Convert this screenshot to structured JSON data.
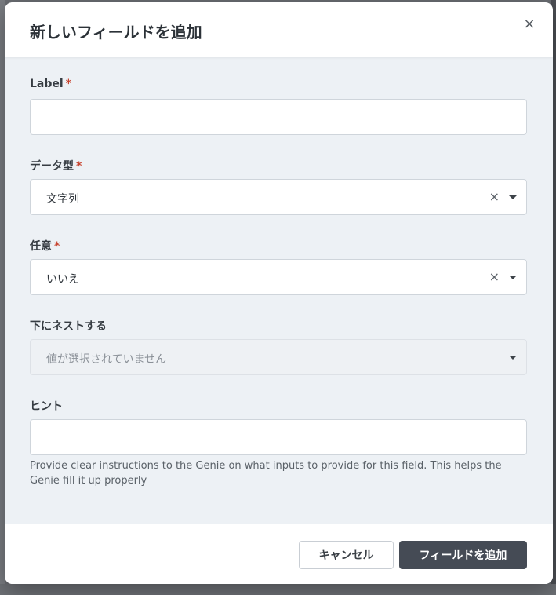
{
  "dialog": {
    "title": "新しいフィールドを追加",
    "close_label": "×"
  },
  "fields": {
    "label": {
      "label": "Label",
      "required_mark": "*",
      "value": ""
    },
    "data_type": {
      "label": "データ型",
      "required_mark": "*",
      "value": "文字列",
      "clear_icon": "×"
    },
    "optional": {
      "label": "任意",
      "required_mark": "*",
      "value": "いいえ",
      "clear_icon": "×"
    },
    "nest_under": {
      "label": "下にネストする",
      "placeholder": "値が選択されていません"
    },
    "hint": {
      "label": "ヒント",
      "value": "",
      "help_text": "Provide clear instructions to the Genie on what inputs to provide for this field. This helps the Genie fill it up properly"
    }
  },
  "footer": {
    "cancel_label": "キャンセル",
    "submit_label": "フィールドを追加"
  },
  "colors": {
    "required": "#c8442f",
    "primary_button": "#454b55",
    "modal_body": "#edf1f5"
  }
}
